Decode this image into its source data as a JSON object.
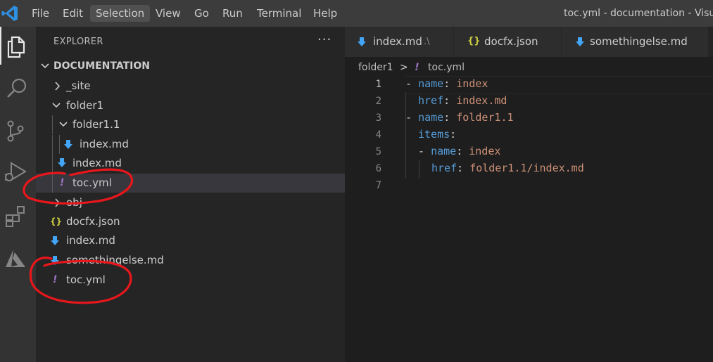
{
  "menubar": {
    "items": [
      "File",
      "Edit",
      "Selection",
      "View",
      "Go",
      "Run",
      "Terminal",
      "Help"
    ],
    "active": "Selection",
    "window_title": "toc.yml - documentation - Visual"
  },
  "activitybar": {
    "icons": [
      "explorer-icon",
      "search-icon",
      "source-control-icon",
      "run-debug-icon",
      "extensions-icon",
      "azure-icon"
    ]
  },
  "sidebar": {
    "title": "EXPLORER",
    "more": "···",
    "root": "DOCUMENTATION",
    "tree": [
      {
        "label": "_site",
        "type": "folder",
        "expanded": false
      },
      {
        "label": "folder1",
        "type": "folder",
        "expanded": true
      },
      {
        "label": "folder1.1",
        "type": "folder",
        "expanded": true
      },
      {
        "label": "index.md",
        "type": "md"
      },
      {
        "label": "index.md",
        "type": "md"
      },
      {
        "label": "toc.yml",
        "type": "yml",
        "selected": true
      },
      {
        "label": "obj",
        "type": "folder",
        "expanded": false
      },
      {
        "label": "docfx.json",
        "type": "json"
      },
      {
        "label": "index.md",
        "type": "md"
      },
      {
        "label": "somethingelse.md",
        "type": "md"
      },
      {
        "label": "toc.yml",
        "type": "yml"
      }
    ]
  },
  "tabs": [
    {
      "label": "index.md",
      "description": ".\\",
      "icon": "markdown-icon"
    },
    {
      "label": "docfx.json",
      "icon": "json-icon"
    },
    {
      "label": "somethingelse.md",
      "icon": "markdown-icon"
    }
  ],
  "breadcrumb": {
    "folder": "folder1",
    "separator": ">",
    "file": "toc.yml"
  },
  "editor": {
    "line_numbers": [
      "1",
      "2",
      "3",
      "4",
      "5",
      "6",
      "7"
    ],
    "lines": [
      {
        "dash": "- ",
        "key": "name",
        "colon": ": ",
        "value": "index"
      },
      {
        "dash": "",
        "key": "href",
        "colon": ": ",
        "value": "index.md"
      },
      {
        "dash": "- ",
        "key": "name",
        "colon": ": ",
        "value": "folder1.1"
      },
      {
        "dash": "",
        "key": "items",
        "colon": ":",
        "value": ""
      },
      {
        "dash": "- ",
        "key": "name",
        "colon": ": ",
        "value": "index"
      },
      {
        "dash": "",
        "key": "href",
        "colon": ": ",
        "value": "folder1.1/index.md"
      }
    ]
  },
  "colors": {
    "annotation": "#e8171c",
    "yaml_key": "#569cd6",
    "yaml_value": "#ce9178",
    "vscode_blue": "#2f8fe0"
  }
}
